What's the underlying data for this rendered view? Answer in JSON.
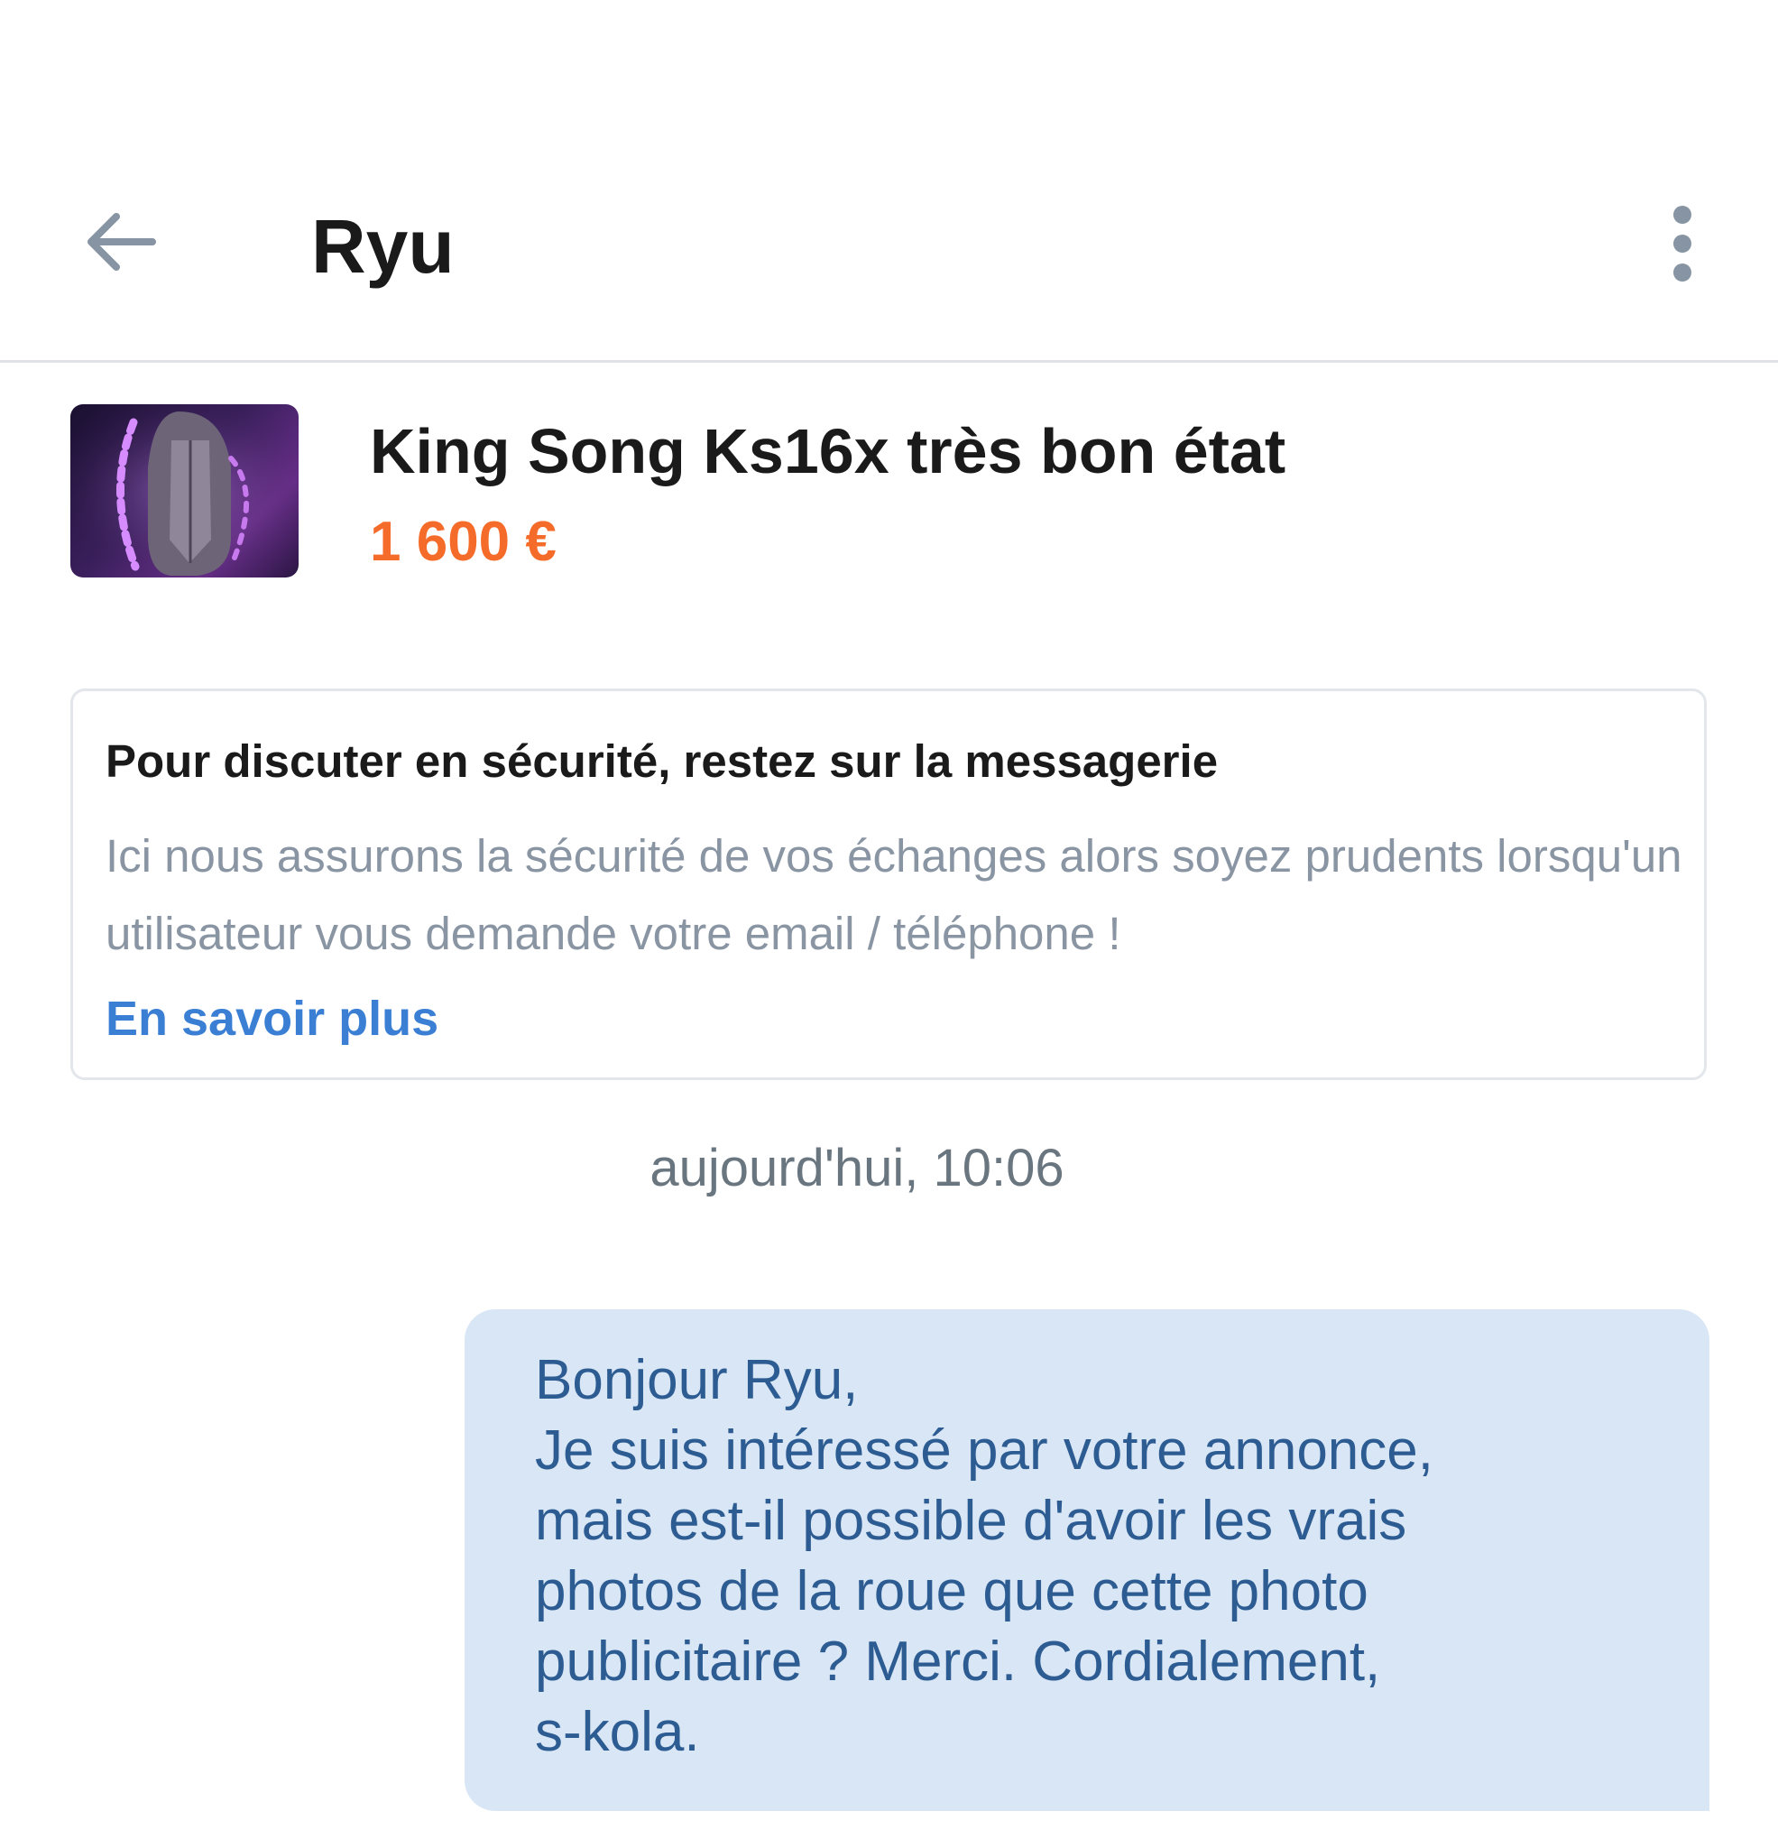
{
  "header": {
    "back_icon": "arrow-left-icon",
    "title": "Ryu",
    "more_icon": "more-vertical-icon"
  },
  "listing": {
    "thumbnail": "monowheel-image",
    "title": "King Song Ks16x très bon état",
    "price": "1 600 €",
    "price_color": "#f56b2a"
  },
  "notice": {
    "title": "Pour discuter en sécurité, restez sur la messagerie",
    "body": "Ici nous assurons la sécurité de vos échanges alors soyez prudents lorsqu'un utilisateur vous demande votre email / téléphone !",
    "link": "En savoir plus",
    "link_color": "#3a7fd4"
  },
  "conversation": {
    "timestamp": "aujourd'hui, 10:06",
    "messages": [
      {
        "text": "Bonjour Ryu,\nJe suis intéressé par votre annonce,\nmais est-il possible d'avoir les vrais\nphotos de la roue que cette photo\npublicitaire ? Merci. Cordialement,\ns-kola.",
        "bubble_color": "#d9e6f6"
      }
    ]
  }
}
